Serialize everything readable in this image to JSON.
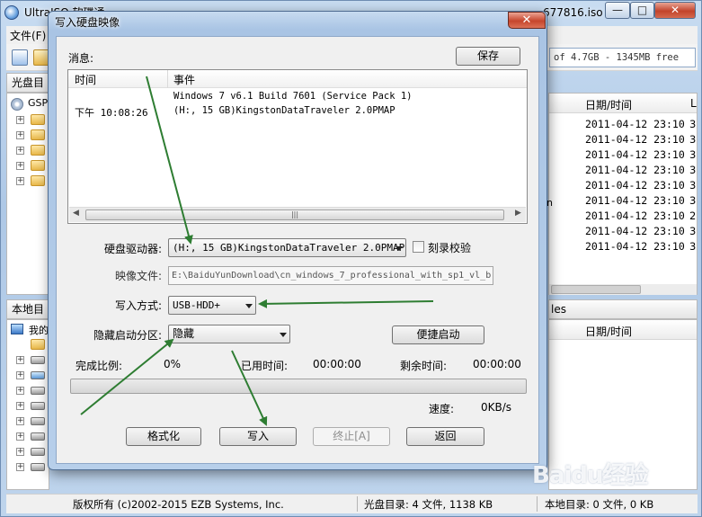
{
  "main_window": {
    "title_head": "UltraISO 软碟通",
    "title_tail": "677816.iso",
    "caption": {
      "min": "—",
      "max": "□",
      "close": "✕"
    },
    "menu_file": "文件(F)",
    "free_space": "of 4.7GB - 1345MB free",
    "left_top_header": "光盘目",
    "left_top_tree_root": "GSP",
    "left_bottom_header": "本地目",
    "left_bottom_tree_root": "我的",
    "right_top_header_date": "日期/时间",
    "right_top_header_l": "L",
    "right_bottom_header_les": "les",
    "right_bottom_header_date": "日期/时间",
    "mid_char": "n",
    "file_rows": [
      {
        "date": "2011-04-12 23:10",
        "n": "3"
      },
      {
        "date": "2011-04-12 23:10",
        "n": "3"
      },
      {
        "date": "2011-04-12 23:10",
        "n": "3"
      },
      {
        "date": "2011-04-12 23:10",
        "n": "3"
      },
      {
        "date": "2011-04-12 23:10",
        "n": "3"
      },
      {
        "date": "2011-04-12 23:10",
        "n": "3"
      },
      {
        "date": "2011-04-12 23:10",
        "n": "2"
      },
      {
        "date": "2011-04-12 23:10",
        "n": "3"
      },
      {
        "date": "2011-04-12 23:10",
        "n": "3"
      }
    ],
    "status": {
      "copyright": "版权所有 (c)2002-2015 EZB Systems, Inc.",
      "cd_dir": "光盘目录: 4 文件, 1138 KB",
      "local_dir": "本地目录: 0 文件, 0 KB"
    }
  },
  "dialog": {
    "title": "写入硬盘映像",
    "close": "✕",
    "messages_label": "消息:",
    "save_button": "保存",
    "log_headers": {
      "time": "时间",
      "event": "事件"
    },
    "log_entries": [
      {
        "time": "",
        "event": "Windows 7 v6.1 Build 7601 (Service Pack 1)"
      },
      {
        "time": "下午 10:08:26",
        "event": "(H:, 15 GB)KingstonDataTraveler 2.0PMAP"
      }
    ],
    "scroll_grip": "|||",
    "drive_label": "硬盘驱动器:",
    "drive_value": "(H:, 15 GB)KingstonDataTraveler 2.0PMAP",
    "verify_label": "刻录校验",
    "image_label": "映像文件:",
    "image_value": "E:\\BaiduYunDownload\\cn_windows_7_professional_with_sp1_vl_b",
    "write_mode_label": "写入方式:",
    "write_mode_value": "USB-HDD+",
    "hide_boot_label": "隐藏启动分区:",
    "hide_boot_value": "隐藏",
    "quick_boot_button": "便捷启动",
    "progress_label": "完成比例:",
    "progress_value": "0%",
    "progress_fraction": 0,
    "elapsed_label": "已用时间:",
    "elapsed_value": "00:00:00",
    "remaining_label": "剩余时间:",
    "remaining_value": "00:00:00",
    "speed_label": "速度:",
    "speed_value": "0KB/s",
    "buttons": {
      "format": "格式化",
      "write": "写入",
      "stop": "终止[A]",
      "back": "返回"
    }
  },
  "watermark": "Baidu经验",
  "colors": {
    "arrow": "#2e7d32",
    "close_red": "#c6452c",
    "title_blue": "#a9c4e4"
  }
}
